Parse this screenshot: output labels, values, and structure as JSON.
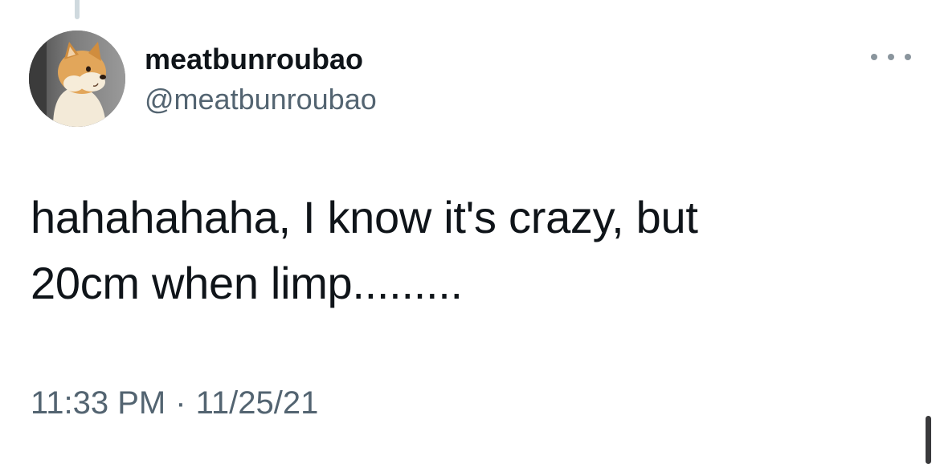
{
  "tweet": {
    "author": {
      "display_name": "meatbunroubao",
      "handle": "@meatbunroubao",
      "avatar_icon": "shiba-dog-avatar"
    },
    "more_icon": "more-horizontal-icon",
    "text_lines": [
      "hahahahaha, I know it's crazy, but",
      "20cm when limp........."
    ],
    "time": "11:33 PM",
    "separator": "·",
    "date": "11/25/21"
  },
  "colors": {
    "text_primary": "#0f1419",
    "text_secondary": "#536471",
    "background": "#ffffff",
    "thread_line": "#cfd9de"
  }
}
